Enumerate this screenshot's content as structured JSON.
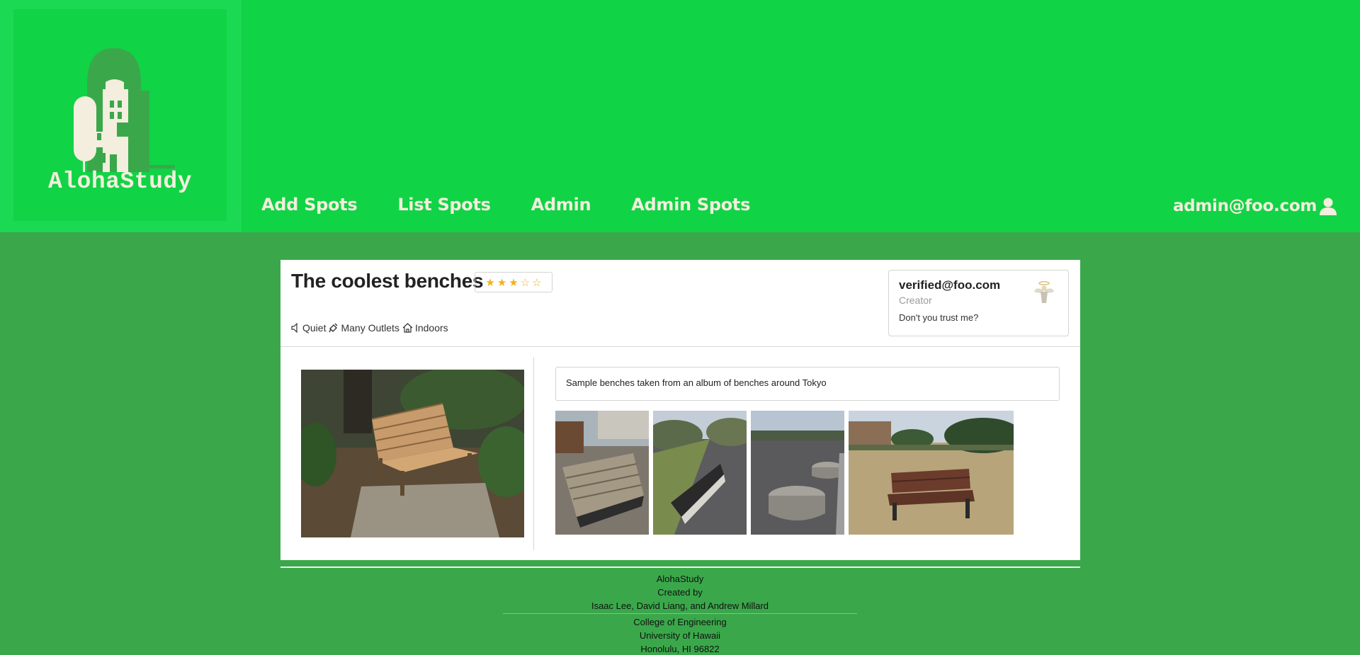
{
  "brand": {
    "name": "AlohaStudy"
  },
  "nav": {
    "items": [
      "Add Spots",
      "List Spots",
      "Admin",
      "Admin Spots"
    ],
    "user_email": "admin@foo.com"
  },
  "spot": {
    "title": "The coolest benches",
    "rating": {
      "value": 3,
      "max": 5
    },
    "tags": [
      {
        "icon": "speaker-icon",
        "label": "Quiet"
      },
      {
        "icon": "plug-icon",
        "label": "Many Outlets"
      },
      {
        "icon": "house-icon",
        "label": "Indoors"
      }
    ],
    "description": "Sample benches taken from an album of benches around Tokyo"
  },
  "creator": {
    "email": "verified@foo.com",
    "role": "Creator",
    "quote": "Don't you trust me?"
  },
  "footer": {
    "line1": "AlohaStudy",
    "line2": "Created by",
    "line3": "Isaac Lee, David Liang, and Andrew Millard",
    "line4": "College of Engineering",
    "line5": "University of Hawaii",
    "line6": "Honolulu, HI 96822"
  },
  "colors": {
    "header_bg": "#11d346",
    "page_bg": "#3aa84a",
    "nav_text": "#f3eedd",
    "star": "#f2b01e"
  }
}
